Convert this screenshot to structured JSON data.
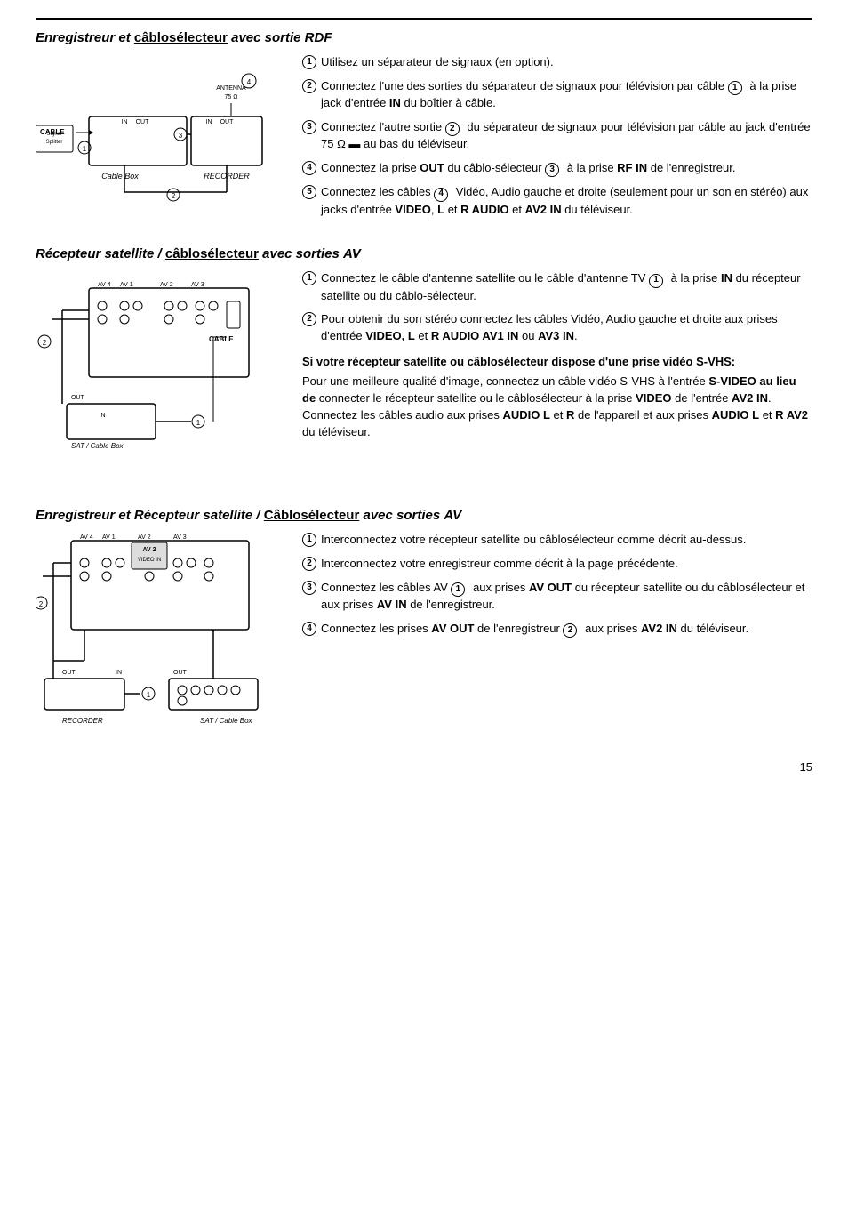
{
  "page": {
    "number": "15",
    "rule_top": true
  },
  "section1": {
    "title_italic": "Enregistreur et ",
    "title_bold1": "câblosélecteur",
    "title_mid": " avec sortie ",
    "title_bold2": "RDF",
    "instructions": [
      {
        "num": "1",
        "text": "Utilisez un séparateur de signaux (en option)."
      },
      {
        "num": "2",
        "text_before": "Connectez l'une des sorties du séparateur de signaux pour télévision par câble ",
        "circled": "1",
        "text_after": " à la prise jack d'entrée ",
        "bold": "IN",
        "text_end": " du boîtier à câble."
      },
      {
        "num": "3",
        "text": "Connectez l'autre sortie ",
        "circled": "2",
        "text_after": " du séparateur de signaux pour télévision par câble au jack d'entrée 75 Ω ▬ au bas du téléviseur."
      },
      {
        "num": "4",
        "text_before": "Connectez la prise ",
        "bold1": "OUT",
        "text_mid": " du câblo-sélecteur ",
        "circled": "3",
        "text_mid2": " à la prise ",
        "bold2": "RF IN",
        "text_end": " de l'enregistreur."
      },
      {
        "num": "5",
        "text_before": "Connectez les câbles ",
        "circled": "4",
        "text_after": " Vidéo, Audio gauche et droite (seulement pour un son en stéréo) aux jacks d'entrée ",
        "bold1": "VIDEO",
        "text_sep": ", ",
        "bold2": "L",
        "text_sep2": " et ",
        "bold3": "R AUDIO",
        "text_sep3": " et ",
        "bold4": "AV2 IN",
        "text_end": " du téléviseur."
      }
    ],
    "diagram_label": "Cable Box",
    "diagram_label2": "RECORDER"
  },
  "section2": {
    "title_italic": "Récepteur satellite / ",
    "title_bold1": "câblosélecteur",
    "title_mid": " avec sorties ",
    "title_bold2": "AV",
    "instructions": [
      {
        "num": "1",
        "text": "Connectez le câble d'antenne satellite ou le câble d'antenne TV ",
        "circled": "1",
        "text_after": " à la prise ",
        "bold": "IN",
        "text_end": " du récepteur satellite ou du câblo-sélecteur."
      },
      {
        "num": "2",
        "text_before": "Pour obtenir du son stéréo connectez les câbles Vidéo, Audio gauche et droite aux prises d'entrée ",
        "bold": "VIDEO, L",
        "text_mid": " et ",
        "bold2": "R AUDIO AV1 IN",
        "text_mid2": " ou ",
        "bold3": "AV3 IN",
        "text_end": "."
      }
    ],
    "svhs_title": "Si votre récepteur satellite ou câblosélecteur dispose d'une prise vidéo S-VHS:",
    "svhs_body1_before": "Pour une meilleure qualité d'image, connectez un câble vidéo S-VHS à l'entrée ",
    "svhs_bold1": "S-VIDEO au lieu de",
    "svhs_body1_after": " connecter le récepteur satellite ou le câblosélecteur à la prise ",
    "svhs_bold2": "VIDEO",
    "svhs_body1_end": " de l'entrée ",
    "svhs_bold3": "AV2 IN",
    "svhs_body2_before": ".\nConnectez les câbles audio aux prises ",
    "svhs_bold4": "AUDIO L",
    "svhs_body2_mid": " et ",
    "svhs_bold5": "R",
    "svhs_body2_mid2": " de l'appareil et aux prises ",
    "svhs_bold6": "AUDIO L",
    "svhs_body2_mid3": " et ",
    "svhs_bold7": "R AV2",
    "svhs_body2_end": " du téléviseur.",
    "diagram_label": "SAT / Cable Box"
  },
  "section3": {
    "title_italic": "Enregistreur et Récepteur satellite / ",
    "title_bold1": "Câblosélecteur",
    "title_mid": " avec sorties ",
    "title_bold2": "AV",
    "instructions": [
      {
        "num": "1",
        "text": "Interconnectez votre récepteur satellite ou câblosélecteur comme décrit au-dessus."
      },
      {
        "num": "2",
        "text": "Interconnectez votre enregistreur comme décrit à la page précédente."
      },
      {
        "num": "3",
        "text_before": "Connectez les câbles AV ",
        "circled": "1",
        "text_after": " aux prises ",
        "bold1": "AV OUT",
        "text_mid": " du récepteur satellite ou du câblosélecteur et aux prises ",
        "bold2": "AV IN",
        "text_end": " de l'enregistreur."
      },
      {
        "num": "4",
        "text_before": "Connectez les prises ",
        "bold1": "AV OUT",
        "text_mid": " de l'enregistreur ",
        "circled": "2",
        "text_after": " aux prises ",
        "bold2": "AV2 IN",
        "text_end": " du téléviseur."
      }
    ],
    "diagram_label1": "RECORDER",
    "diagram_label2": "SAT / Cable Box"
  }
}
